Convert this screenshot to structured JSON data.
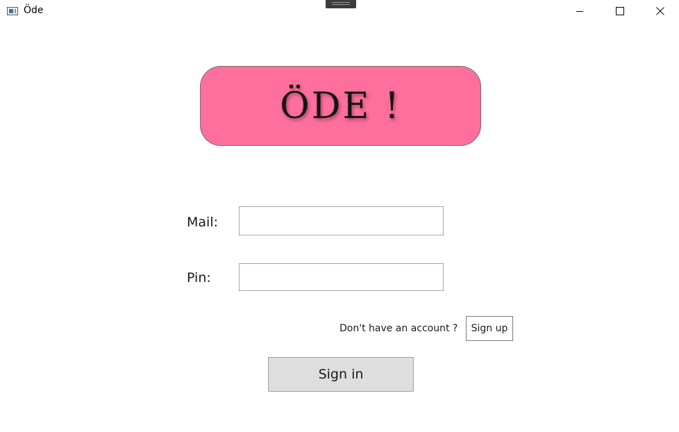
{
  "window": {
    "title": "Öde",
    "icons": {
      "app": "app-icon",
      "minimize": "minimize-icon",
      "maximize": "maximize-icon",
      "close": "close-icon"
    }
  },
  "logo": {
    "text": "ÖDE ! ",
    "background_color": "#ff6f9d"
  },
  "form": {
    "mail_label": "Mail:",
    "mail_value": "",
    "pin_label": "Pin:",
    "pin_value": ""
  },
  "signup": {
    "prompt": "Don't have an account ?",
    "button_label": "Sign up"
  },
  "signin": {
    "button_label": "Sign in"
  },
  "colors": {
    "signin_button_bg": "#dedede"
  }
}
